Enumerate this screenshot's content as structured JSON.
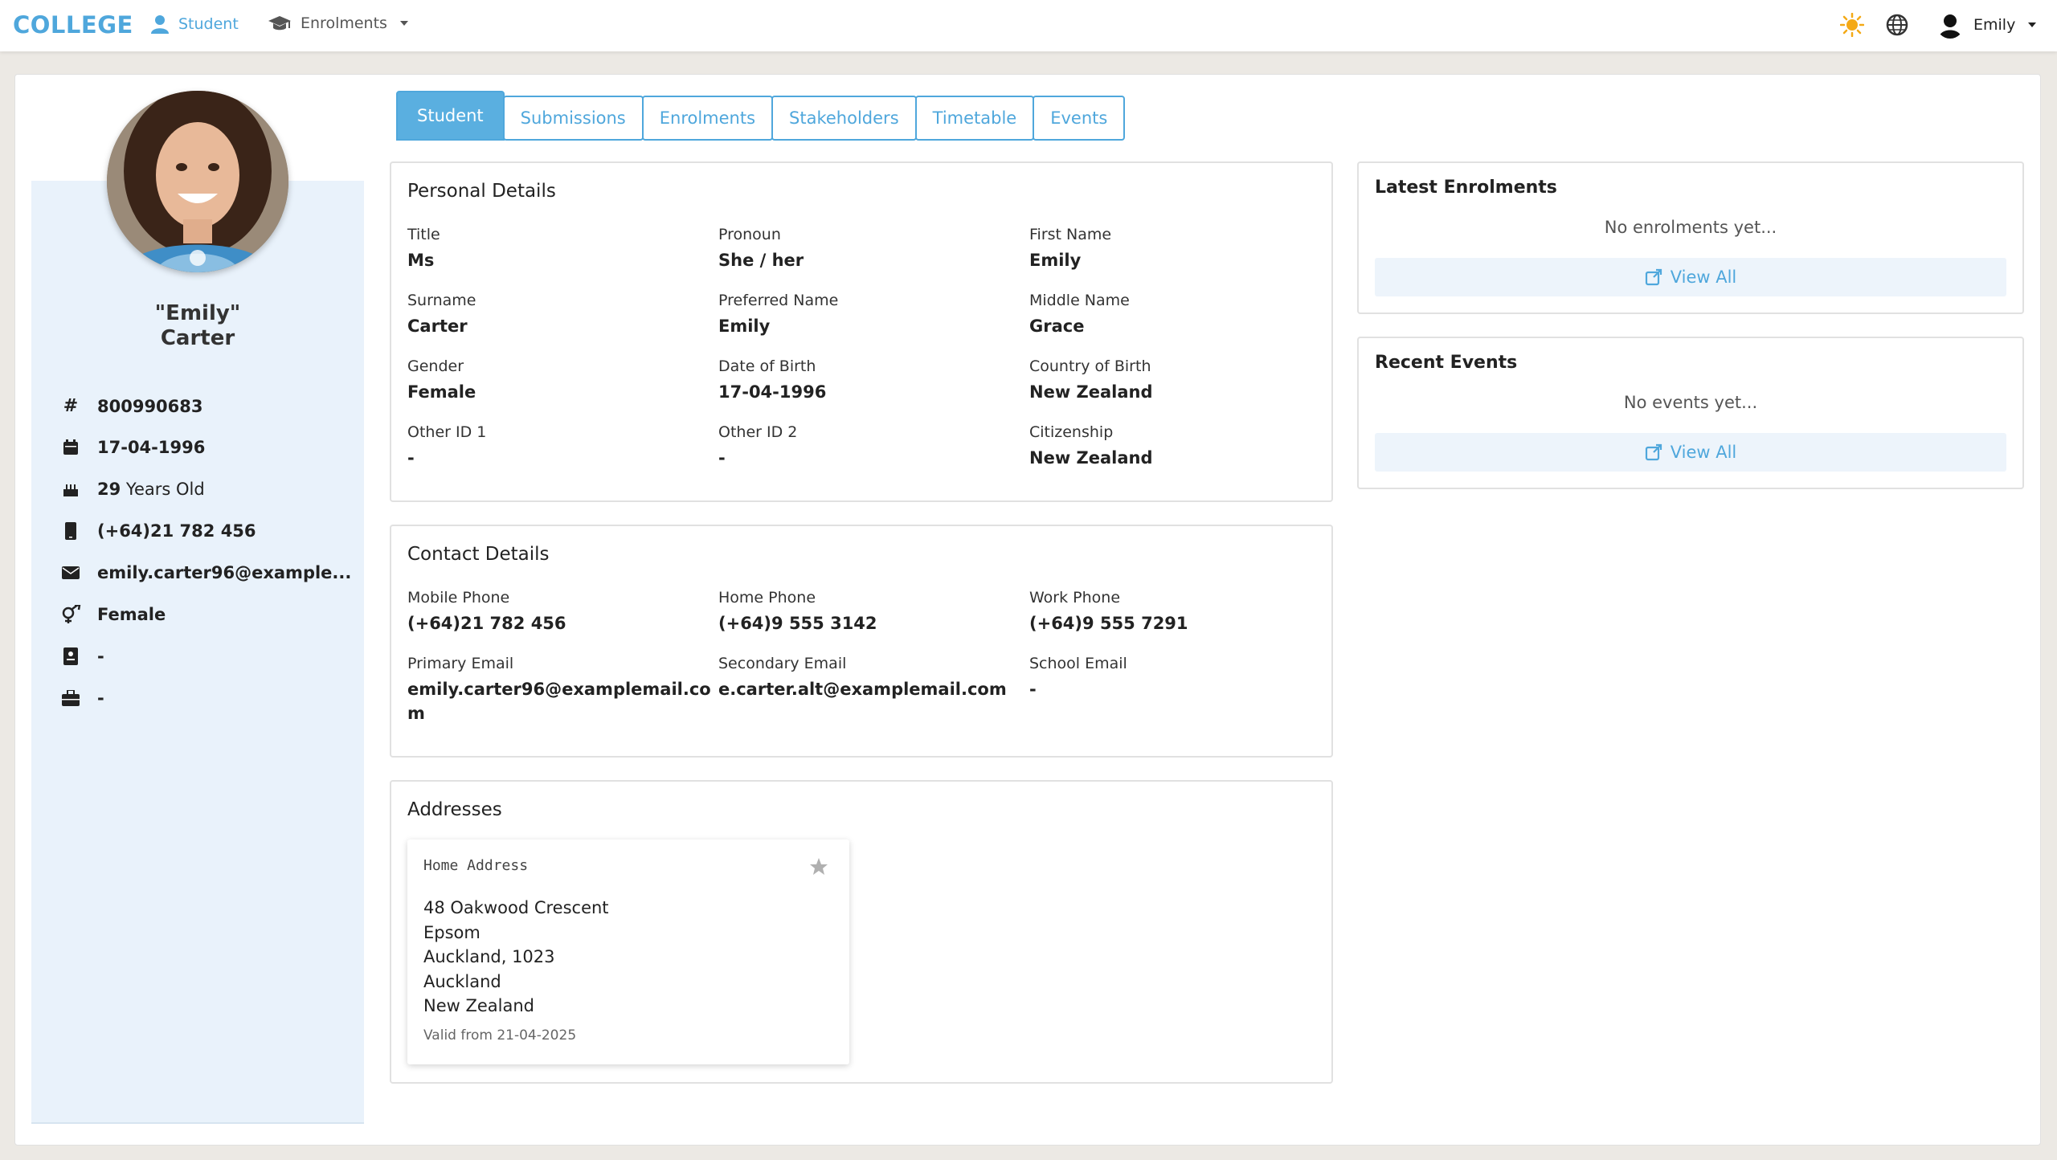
{
  "nav": {
    "brand": "COLLEGE",
    "student_label": "Student",
    "enrolments_label": "Enrolments",
    "user_name": "Emily"
  },
  "profile": {
    "name_line1": "\"Emily\"",
    "name_line2": "Carter",
    "rows": {
      "id": "800990683",
      "dob": "17-04-1996",
      "age_num": "29",
      "age_suffix": "Years Old",
      "phone": "(+64)21 782 456",
      "email": "emily.carter96@example...",
      "gender": "Female",
      "other1": "-",
      "other2": "-"
    }
  },
  "tabs": [
    "Student",
    "Submissions",
    "Enrolments",
    "Stakeholders",
    "Timetable",
    "Events"
  ],
  "personal": {
    "title": "Personal Details",
    "fields": [
      {
        "label": "Title",
        "value": "Ms"
      },
      {
        "label": "Pronoun",
        "value": "She / her"
      },
      {
        "label": "First Name",
        "value": "Emily"
      },
      {
        "label": "Surname",
        "value": "Carter"
      },
      {
        "label": "Preferred Name",
        "value": "Emily"
      },
      {
        "label": "Middle Name",
        "value": "Grace"
      },
      {
        "label": "Gender",
        "value": "Female"
      },
      {
        "label": "Date of Birth",
        "value": "17-04-1996"
      },
      {
        "label": "Country of Birth",
        "value": "New Zealand"
      },
      {
        "label": "Other ID 1",
        "value": "-"
      },
      {
        "label": "Other ID 2",
        "value": "-"
      },
      {
        "label": "Citizenship",
        "value": "New Zealand"
      }
    ]
  },
  "contact": {
    "title": "Contact Details",
    "fields": [
      {
        "label": "Mobile Phone",
        "value": "(+64)21 782 456"
      },
      {
        "label": "Home Phone",
        "value": "(+64)9 555 3142"
      },
      {
        "label": "Work Phone",
        "value": "(+64)9 555 7291"
      },
      {
        "label": "Primary Email",
        "value": "emily.carter96@examplemail.co\nm"
      },
      {
        "label": "Secondary Email",
        "value": "e.carter.alt@examplemail.com"
      },
      {
        "label": "School Email",
        "value": "-"
      }
    ]
  },
  "addresses": {
    "title": "Addresses",
    "card": {
      "type": "Home Address",
      "line1": "48 Oakwood Crescent",
      "line2": "Epsom",
      "line3": "Auckland, 1023",
      "line4": "Auckland",
      "line5": "New Zealand",
      "valid": "Valid from 21-04-2025"
    }
  },
  "latest_enrolments": {
    "title": "Latest Enrolments",
    "empty": "No enrolments yet...",
    "view_all": "View All"
  },
  "recent_events": {
    "title": "Recent Events",
    "empty": "No events yet...",
    "view_all": "View All"
  },
  "colors": {
    "accent": "#4fa7dc",
    "sidebar_bg": "#e9f2fb",
    "page_bg": "#ece9e4"
  }
}
